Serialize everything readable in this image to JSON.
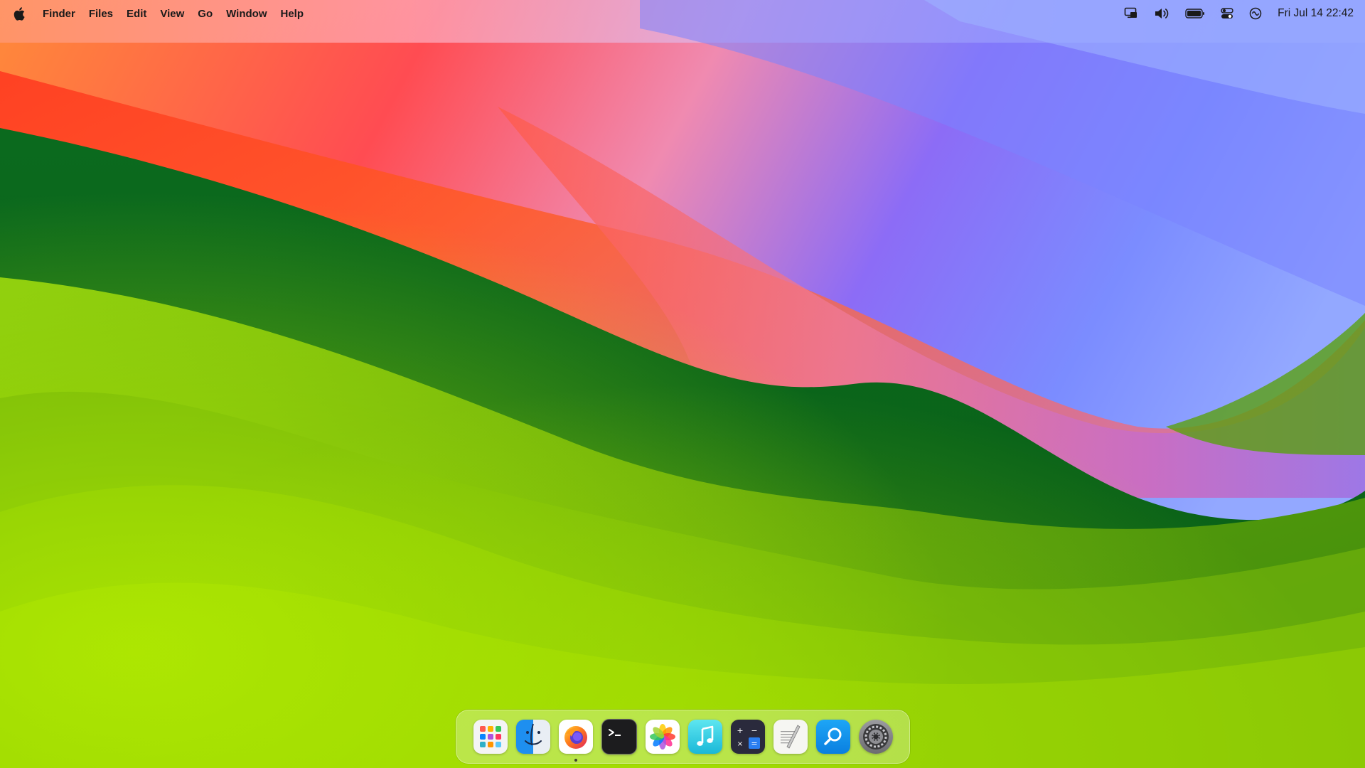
{
  "menubar": {
    "app_name": "Finder",
    "menus": [
      "Files",
      "Edit",
      "View",
      "Go",
      "Window",
      "Help"
    ],
    "status_icons": [
      "display-mirroring-icon",
      "volume-icon",
      "battery-icon",
      "control-center-icon",
      "siri-icon"
    ],
    "clock": "Fri Jul 14  22:42"
  },
  "dock": {
    "apps": [
      {
        "name": "Launchpad",
        "icon": "launchpad-icon",
        "running": false
      },
      {
        "name": "Finder",
        "icon": "finder-icon",
        "running": false
      },
      {
        "name": "Firefox",
        "icon": "firefox-icon",
        "running": true
      },
      {
        "name": "Terminal",
        "icon": "terminal-icon",
        "running": false
      },
      {
        "name": "Photos",
        "icon": "photos-icon",
        "running": false
      },
      {
        "name": "Music",
        "icon": "music-icon",
        "running": false
      },
      {
        "name": "Calculator",
        "icon": "calculator-icon",
        "running": false
      },
      {
        "name": "TextEdit",
        "icon": "textedit-icon",
        "running": false
      },
      {
        "name": "Spotlight Search",
        "icon": "spotlight-icon",
        "running": false
      },
      {
        "name": "System Settings",
        "icon": "settings-icon",
        "running": false
      }
    ]
  },
  "colors": {
    "wallpaper_green": "#5a9e10",
    "wallpaper_dark_green": "#0a6a1a",
    "wallpaper_red": "#ff4a3a",
    "wallpaper_orange": "#ff7a30",
    "wallpaper_pink": "#f07aa8",
    "wallpaper_purple": "#8a6cf8",
    "wallpaper_blue": "#7a90ff"
  }
}
